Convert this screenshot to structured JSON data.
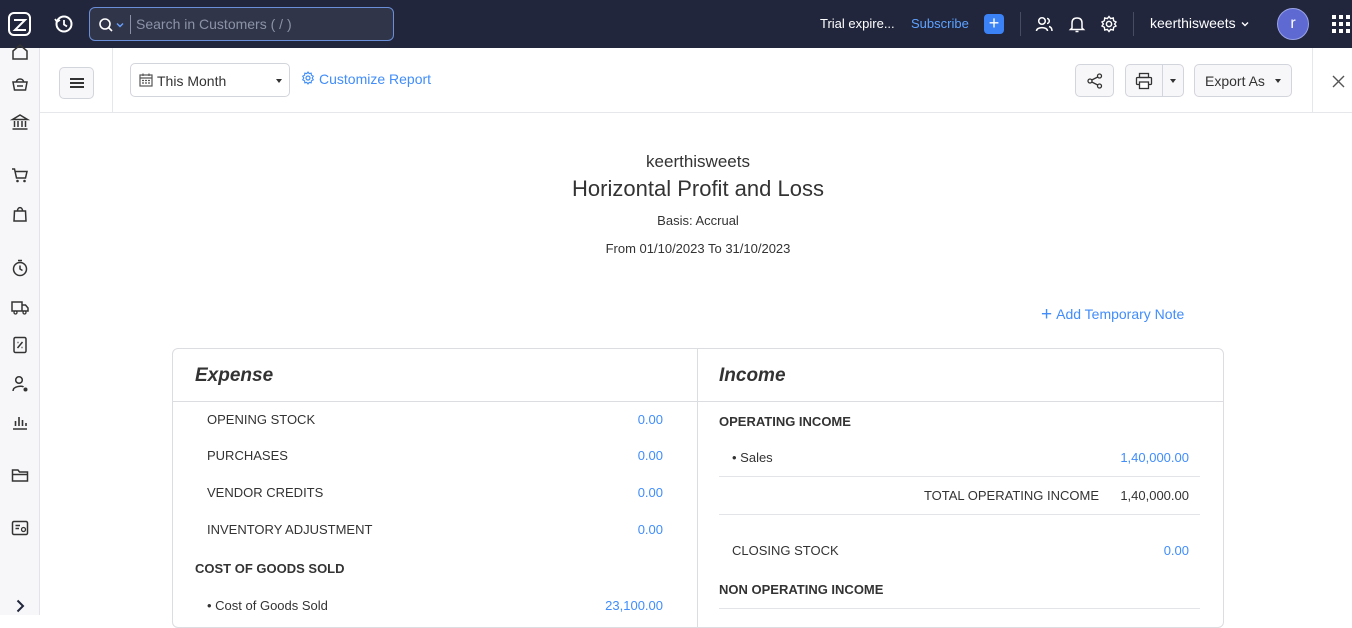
{
  "topbar": {
    "search_placeholder": "Search in Customers ( / )",
    "trial_text": "Trial expire...",
    "subscribe_label": "Subscribe",
    "add_label": "+",
    "org_name": "keerthisweets",
    "avatar_letter": "r"
  },
  "toolbar": {
    "period_label": "This Month",
    "customize_label": "Customize Report",
    "export_label": "Export As"
  },
  "report": {
    "org_name": "keerthisweets",
    "title": "Horizontal Profit and Loss",
    "basis": "Basis: Accrual",
    "date_range": "From 01/10/2023 To 31/10/2023",
    "add_note_label": "Add Temporary Note",
    "add_note_plus": "+",
    "expense": {
      "heading": "Expense",
      "rows": [
        {
          "label": "OPENING STOCK",
          "value": "0.00"
        },
        {
          "label": "PURCHASES",
          "value": "0.00"
        },
        {
          "label": "VENDOR CREDITS",
          "value": "0.00"
        },
        {
          "label": "INVENTORY ADJUSTMENT",
          "value": "0.00"
        }
      ],
      "cogs_section": "COST OF GOODS SOLD",
      "cogs_item": {
        "label": "• Cost of Goods Sold",
        "value": "23,100.00"
      }
    },
    "income": {
      "heading": "Income",
      "operating_section": "OPERATING INCOME",
      "sales_item": {
        "label": "• Sales",
        "value": "1,40,000.00"
      },
      "total_operating": {
        "label": "TOTAL OPERATING INCOME",
        "value": "1,40,000.00"
      },
      "closing_stock": {
        "label": "CLOSING STOCK",
        "value": "0.00"
      },
      "non_operating_section": "NON OPERATING INCOME"
    }
  },
  "colors": {
    "topbar_bg": "#21263c",
    "accent_blue": "#408dfb",
    "subscribe_blue": "#5ea2ff",
    "avatar_bg": "#5e6ad2"
  },
  "icons": {
    "sidebar": [
      "home-icon",
      "items-icon",
      "banking-icon",
      "sales-cart-icon",
      "purchases-bag-icon",
      "time-tracking-icon",
      "eway-bills-truck-icon",
      "gst-filing-icon",
      "accountant-icon",
      "reports-chart-icon",
      "documents-folder-icon",
      "configure-icon",
      "expand-chevron-icon"
    ]
  }
}
